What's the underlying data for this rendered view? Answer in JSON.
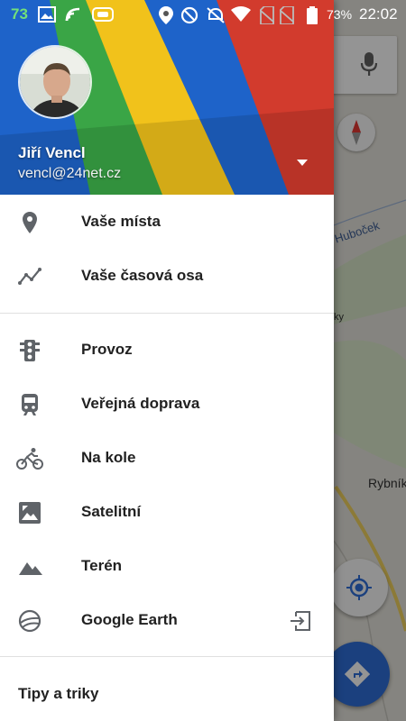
{
  "status_bar": {
    "battery_level_left": "73",
    "battery_percent": "73%",
    "time": "22:02",
    "icons": [
      "image-icon",
      "cast-icon",
      "gamepad-icon",
      "location-icon",
      "do-not-disturb-icon",
      "alarm-off-icon",
      "wifi-icon",
      "no-sim-icon",
      "no-sim-icon",
      "battery-icon"
    ]
  },
  "drawer": {
    "header": {
      "user_name": "Jiří Vencl",
      "user_email": "vencl@24net.cz"
    },
    "section1": [
      {
        "label": "Vaše místa",
        "icon": "place-pin-icon"
      },
      {
        "label": "Vaše časová osa",
        "icon": "timeline-icon"
      }
    ],
    "section2": [
      {
        "label": "Provoz",
        "icon": "traffic-light-icon"
      },
      {
        "label": "Veřejná doprava",
        "icon": "train-icon"
      },
      {
        "label": "Na kole",
        "icon": "bicycle-icon"
      },
      {
        "label": "Satelitní",
        "icon": "satellite-image-icon"
      },
      {
        "label": "Terén",
        "icon": "terrain-icon"
      },
      {
        "label": "Google Earth",
        "icon": "google-earth-icon",
        "trailing_icon": "open-app-icon"
      }
    ],
    "footer_item": "Tipy a triky"
  },
  "map": {
    "labels": [
      "Hubоček",
      "Rybník",
      "ky"
    ]
  },
  "colors": {
    "map_button_blue": "#2f6fd9",
    "battery_green": "#72e07a",
    "header_blue": "#1e63c9",
    "header_green": "#3aa546",
    "header_yellow": "#f1c21b",
    "header_red": "#d23b2d"
  }
}
